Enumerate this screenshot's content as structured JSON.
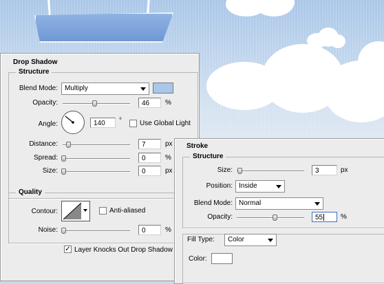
{
  "drop_shadow": {
    "title": "Drop Shadow",
    "structure": {
      "heading": "Structure",
      "blend_mode_label": "Blend Mode:",
      "blend_mode_value": "Multiply",
      "shadow_color": "#a9c7ea",
      "opacity_label": "Opacity:",
      "opacity_value": "46",
      "opacity_unit": "%",
      "angle_label": "Angle:",
      "angle_value": "140",
      "angle_unit": "°",
      "global_light_label": "Use Global Light",
      "global_light_checked": false,
      "distance_label": "Distance:",
      "distance_value": "7",
      "distance_unit": "px",
      "spread_label": "Spread:",
      "spread_value": "0",
      "spread_unit": "%",
      "size_label": "Size:",
      "size_value": "0",
      "size_unit": "px"
    },
    "quality": {
      "heading": "Quality",
      "contour_label": "Contour:",
      "anti_aliased_label": "Anti-aliased",
      "noise_label": "Noise:",
      "noise_value": "0",
      "noise_unit": "%"
    },
    "knockout_label": "Layer Knocks Out Drop Shadow",
    "knockout_checked": true
  },
  "stroke": {
    "title": "Stroke",
    "structure": {
      "heading": "Structure",
      "size_label": "Size:",
      "size_value": "3",
      "size_unit": "px",
      "position_label": "Position:",
      "position_value": "Inside",
      "blend_mode_label": "Blend Mode:",
      "blend_mode_value": "Normal",
      "opacity_label": "Opacity:",
      "opacity_value": "55",
      "opacity_unit": "%"
    },
    "fill": {
      "fill_type_label": "Fill Type:",
      "fill_type_value": "Color",
      "color_label": "Color:",
      "color_value": "#ffffff"
    }
  }
}
